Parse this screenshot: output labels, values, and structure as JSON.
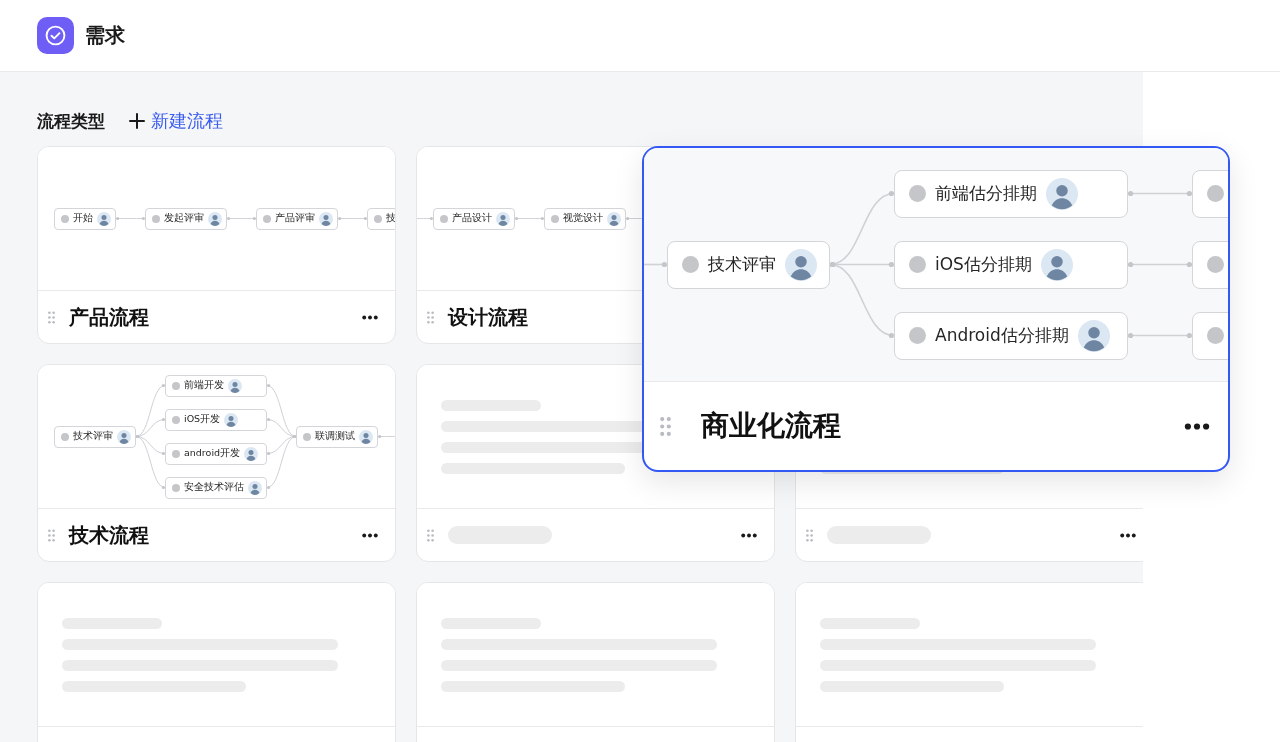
{
  "app": {
    "title": "需求"
  },
  "section": {
    "title": "流程类型",
    "new_button": {
      "label": "新建流程"
    }
  },
  "cards": [
    {
      "kind": "flow",
      "highlighted": false,
      "title": "产品流程",
      "graph": {
        "lead_in": false,
        "stages": [
          [
            {
              "label": "开始",
              "avatar": true
            }
          ],
          [
            {
              "label": "发起评审",
              "avatar": true
            }
          ],
          [
            {
              "label": "产品评审",
              "avatar": true
            }
          ],
          [
            {
              "label": "技",
              "avatar": false
            }
          ]
        ]
      }
    },
    {
      "kind": "flow",
      "highlighted": false,
      "title": "设计流程",
      "graph": {
        "lead_in": true,
        "stages": [
          [
            {
              "label": "产品设计",
              "avatar": true
            }
          ],
          [
            {
              "label": "视觉设计",
              "avatar": true
            }
          ]
        ]
      }
    },
    {
      "kind": "flow",
      "highlighted": true,
      "title": "商业化流程",
      "graph": {
        "lead_in": true,
        "stages": [
          [
            {
              "label": "技术评审",
              "avatar": true
            }
          ],
          [
            {
              "label": "前端估分排期",
              "avatar": true
            },
            {
              "label": "iOS估分排期",
              "avatar": true
            },
            {
              "label": "Android估分排期",
              "avatar": true
            }
          ],
          [
            {
              "avatar": false
            },
            {
              "avatar": false
            },
            {
              "avatar": false
            }
          ]
        ]
      }
    },
    {
      "kind": "flow",
      "highlighted": false,
      "title": "技术流程",
      "graph": {
        "lead_in": false,
        "stages": [
          [
            {
              "label": "技术评审",
              "avatar": true
            }
          ],
          [
            {
              "label": "前端开发",
              "avatar": true
            },
            {
              "label": "iOS开发",
              "avatar": true
            },
            {
              "label": "android开发",
              "avatar": true
            },
            {
              "label": "安全技术评估",
              "avatar": true
            }
          ],
          [
            {
              "label": "联调测试",
              "avatar": true
            }
          ]
        ]
      }
    },
    {
      "kind": "placeholder",
      "highlighted": false
    },
    {
      "kind": "placeholder",
      "highlighted": false
    },
    {
      "kind": "placeholder",
      "highlighted": false
    },
    {
      "kind": "placeholder",
      "highlighted": false
    },
    {
      "kind": "placeholder",
      "highlighted": false
    }
  ]
}
